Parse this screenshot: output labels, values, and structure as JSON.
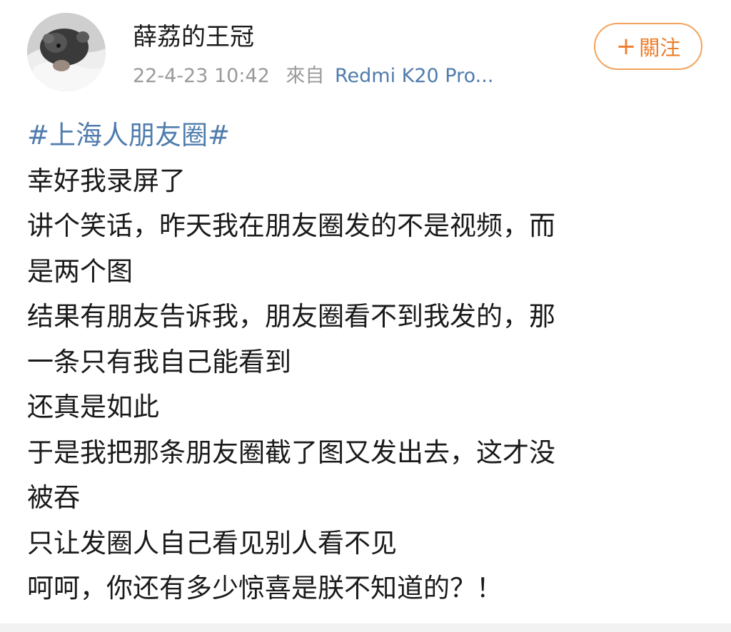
{
  "user": {
    "name": "薛荔的王冠",
    "timestamp": "22-4-23 10:42",
    "source_prefix": "來自",
    "source_device": "Redmi K20 Pro..."
  },
  "follow_button": {
    "icon": "plus-icon",
    "label": "關注",
    "color": "#ee7d2b"
  },
  "post": {
    "hashtag": "#上海人朋友圈#",
    "lines": [
      "幸好我录屏了",
      "讲个笑话，昨天我在朋友圈发的不是视频，而",
      "是两个图",
      "结果有朋友告诉我，朋友圈看不到我发的，那",
      "一条只有我自己能看到",
      "还真是如此",
      "于是我把那条朋友圈截了图又发出去，这才没",
      "被吞",
      "只让发圈人自己看见别人看不见",
      "呵呵，你还有多少惊喜是朕不知道的？！"
    ]
  },
  "colors": {
    "link": "#4f7cad",
    "meta": "#9a9a9a",
    "text": "#1a1a1a",
    "accent": "#ee7d2b"
  }
}
